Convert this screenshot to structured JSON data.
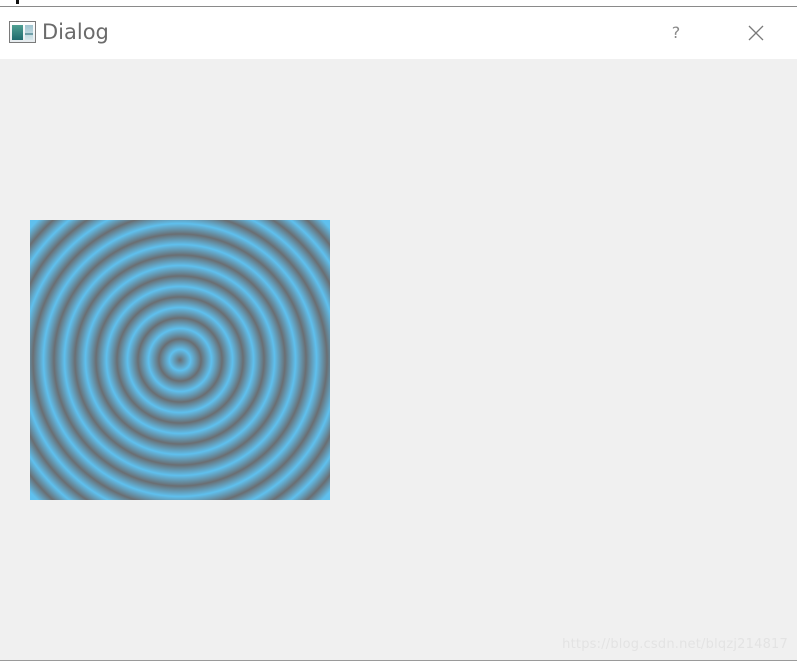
{
  "window": {
    "title": "Dialog",
    "help_label": "?",
    "background": "#f0f0f0",
    "titlebar_background": "#ffffff"
  },
  "canvas": {
    "type": "concentric-rings-gradient",
    "ring_color_light": "#5fc0ee",
    "ring_color_dark": "#6a6e72"
  },
  "watermark": {
    "text": "https://blog.csdn.net/blqzj214817"
  },
  "icons": {
    "app": "dialog-window-icon",
    "help": "question-mark-icon",
    "close": "close-x-icon"
  }
}
